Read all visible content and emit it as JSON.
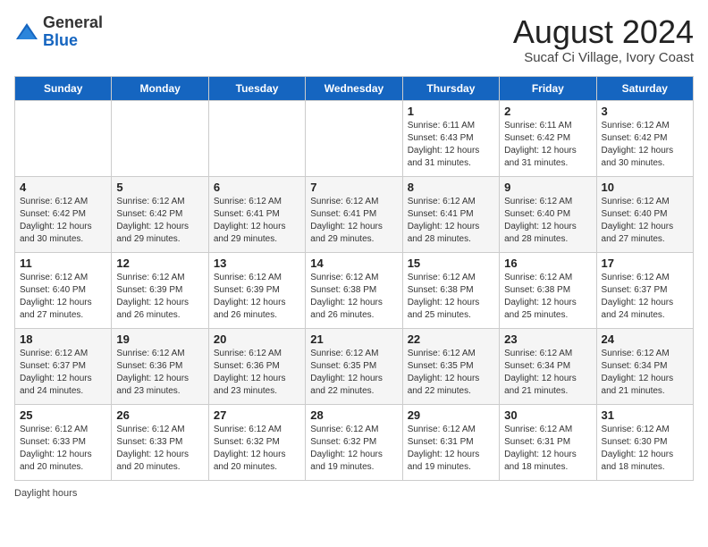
{
  "header": {
    "logo_line1": "General",
    "logo_line2": "Blue",
    "month_year": "August 2024",
    "location": "Sucaf Ci Village, Ivory Coast"
  },
  "days_of_week": [
    "Sunday",
    "Monday",
    "Tuesday",
    "Wednesday",
    "Thursday",
    "Friday",
    "Saturday"
  ],
  "weeks": [
    [
      {
        "day": "",
        "info": ""
      },
      {
        "day": "",
        "info": ""
      },
      {
        "day": "",
        "info": ""
      },
      {
        "day": "",
        "info": ""
      },
      {
        "day": "1",
        "info": "Sunrise: 6:11 AM\nSunset: 6:43 PM\nDaylight: 12 hours\nand 31 minutes."
      },
      {
        "day": "2",
        "info": "Sunrise: 6:11 AM\nSunset: 6:42 PM\nDaylight: 12 hours\nand 31 minutes."
      },
      {
        "day": "3",
        "info": "Sunrise: 6:12 AM\nSunset: 6:42 PM\nDaylight: 12 hours\nand 30 minutes."
      }
    ],
    [
      {
        "day": "4",
        "info": "Sunrise: 6:12 AM\nSunset: 6:42 PM\nDaylight: 12 hours\nand 30 minutes."
      },
      {
        "day": "5",
        "info": "Sunrise: 6:12 AM\nSunset: 6:42 PM\nDaylight: 12 hours\nand 29 minutes."
      },
      {
        "day": "6",
        "info": "Sunrise: 6:12 AM\nSunset: 6:41 PM\nDaylight: 12 hours\nand 29 minutes."
      },
      {
        "day": "7",
        "info": "Sunrise: 6:12 AM\nSunset: 6:41 PM\nDaylight: 12 hours\nand 29 minutes."
      },
      {
        "day": "8",
        "info": "Sunrise: 6:12 AM\nSunset: 6:41 PM\nDaylight: 12 hours\nand 28 minutes."
      },
      {
        "day": "9",
        "info": "Sunrise: 6:12 AM\nSunset: 6:40 PM\nDaylight: 12 hours\nand 28 minutes."
      },
      {
        "day": "10",
        "info": "Sunrise: 6:12 AM\nSunset: 6:40 PM\nDaylight: 12 hours\nand 27 minutes."
      }
    ],
    [
      {
        "day": "11",
        "info": "Sunrise: 6:12 AM\nSunset: 6:40 PM\nDaylight: 12 hours\nand 27 minutes."
      },
      {
        "day": "12",
        "info": "Sunrise: 6:12 AM\nSunset: 6:39 PM\nDaylight: 12 hours\nand 26 minutes."
      },
      {
        "day": "13",
        "info": "Sunrise: 6:12 AM\nSunset: 6:39 PM\nDaylight: 12 hours\nand 26 minutes."
      },
      {
        "day": "14",
        "info": "Sunrise: 6:12 AM\nSunset: 6:38 PM\nDaylight: 12 hours\nand 26 minutes."
      },
      {
        "day": "15",
        "info": "Sunrise: 6:12 AM\nSunset: 6:38 PM\nDaylight: 12 hours\nand 25 minutes."
      },
      {
        "day": "16",
        "info": "Sunrise: 6:12 AM\nSunset: 6:38 PM\nDaylight: 12 hours\nand 25 minutes."
      },
      {
        "day": "17",
        "info": "Sunrise: 6:12 AM\nSunset: 6:37 PM\nDaylight: 12 hours\nand 24 minutes."
      }
    ],
    [
      {
        "day": "18",
        "info": "Sunrise: 6:12 AM\nSunset: 6:37 PM\nDaylight: 12 hours\nand 24 minutes."
      },
      {
        "day": "19",
        "info": "Sunrise: 6:12 AM\nSunset: 6:36 PM\nDaylight: 12 hours\nand 23 minutes."
      },
      {
        "day": "20",
        "info": "Sunrise: 6:12 AM\nSunset: 6:36 PM\nDaylight: 12 hours\nand 23 minutes."
      },
      {
        "day": "21",
        "info": "Sunrise: 6:12 AM\nSunset: 6:35 PM\nDaylight: 12 hours\nand 22 minutes."
      },
      {
        "day": "22",
        "info": "Sunrise: 6:12 AM\nSunset: 6:35 PM\nDaylight: 12 hours\nand 22 minutes."
      },
      {
        "day": "23",
        "info": "Sunrise: 6:12 AM\nSunset: 6:34 PM\nDaylight: 12 hours\nand 21 minutes."
      },
      {
        "day": "24",
        "info": "Sunrise: 6:12 AM\nSunset: 6:34 PM\nDaylight: 12 hours\nand 21 minutes."
      }
    ],
    [
      {
        "day": "25",
        "info": "Sunrise: 6:12 AM\nSunset: 6:33 PM\nDaylight: 12 hours\nand 20 minutes."
      },
      {
        "day": "26",
        "info": "Sunrise: 6:12 AM\nSunset: 6:33 PM\nDaylight: 12 hours\nand 20 minutes."
      },
      {
        "day": "27",
        "info": "Sunrise: 6:12 AM\nSunset: 6:32 PM\nDaylight: 12 hours\nand 20 minutes."
      },
      {
        "day": "28",
        "info": "Sunrise: 6:12 AM\nSunset: 6:32 PM\nDaylight: 12 hours\nand 19 minutes."
      },
      {
        "day": "29",
        "info": "Sunrise: 6:12 AM\nSunset: 6:31 PM\nDaylight: 12 hours\nand 19 minutes."
      },
      {
        "day": "30",
        "info": "Sunrise: 6:12 AM\nSunset: 6:31 PM\nDaylight: 12 hours\nand 18 minutes."
      },
      {
        "day": "31",
        "info": "Sunrise: 6:12 AM\nSunset: 6:30 PM\nDaylight: 12 hours\nand 18 minutes."
      }
    ]
  ],
  "footer": "Daylight hours"
}
